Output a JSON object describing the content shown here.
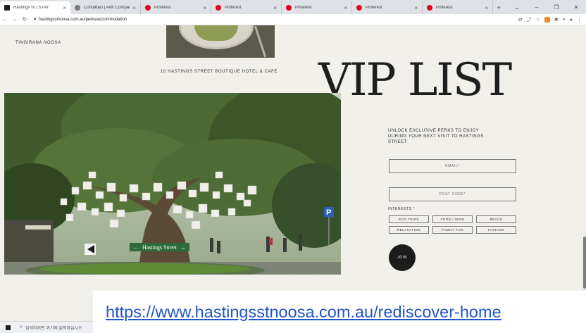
{
  "browser": {
    "tabs": [
      {
        "title": "Hastings St | STAY",
        "favicon_color": "#202124",
        "active": true
      },
      {
        "title": "Contattaci | AVK Company",
        "favicon_color": "#7a7a7a",
        "active": false
      },
      {
        "title": "Pinterest",
        "favicon_color": "#e60023",
        "active": false
      },
      {
        "title": "Pinterest",
        "favicon_color": "#e60023",
        "active": false
      },
      {
        "title": "Pinterest",
        "favicon_color": "#e60023",
        "active": false
      },
      {
        "title": "Pinterest",
        "favicon_color": "#e60023",
        "active": false
      },
      {
        "title": "Pinterest",
        "favicon_color": "#e60023",
        "active": false
      }
    ],
    "tab_close_glyph": "×",
    "new_tab_glyph": "+",
    "url": "hastingsstnoosa.com.au/perks/accommodation"
  },
  "page": {
    "brand_left": "TINGIRANA NOOSA",
    "hotel_caption": "10 HASTINGS STREET BOUTIQUE HOTEL & CAFE",
    "vip": {
      "title": "VIP LIST",
      "description": "UNLOCK EXCLUSIVE PERKS TO ENJOY DURING YOUR NEXT VISIT TO HASTINGS STREET:",
      "email_placeholder": "EMAIL*",
      "postcode_placeholder": "POST CODE*",
      "interests_label": "INTERESTS *",
      "interests": [
        "ECO TRIPS",
        "FOOD / WINE",
        "BEACH",
        "RELAXATION",
        "FAMILY FUN",
        "FASHION"
      ],
      "join_label": "JOIN"
    },
    "photo_sign_text": "Hastings Street",
    "colors": {
      "background": "#f2f0eb",
      "text": "#1e1e1e",
      "join": "#1c1c1c"
    }
  },
  "taskbar": {
    "search_placeholder": "검색하려면 여기에 입력하십시오"
  },
  "overlay": {
    "link_text": "https://www.hastingsstnoosa.com.au/rediscover-home"
  }
}
